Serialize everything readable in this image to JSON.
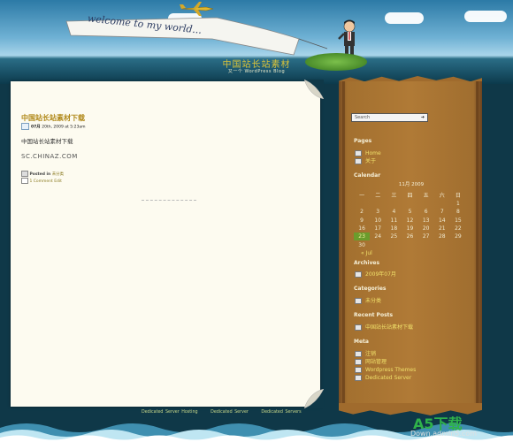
{
  "site": {
    "banner_text": "welcome to my world...",
    "title": "中国站长站素材",
    "tagline": "又一个 WordPress Blog"
  },
  "post": {
    "title": "中国站长站素材下载",
    "date_day": "07月",
    "date_rest": "20th, 2009 at 5:23am",
    "body": "中国站长站素材下载",
    "url_text": "SC.CHINAZ.COM",
    "posted_in_label": "Posted in",
    "category": "未分类",
    "comments_link": "1 Comment Edit"
  },
  "sidebar": {
    "search_placeholder": "Search",
    "pages_heading": "Pages",
    "pages": [
      "Home",
      "关于"
    ],
    "calendar_heading": "Calendar",
    "calendar": {
      "caption": "11月 2009",
      "weekdays": [
        "一",
        "二",
        "三",
        "四",
        "五",
        "六",
        "日"
      ],
      "weeks": [
        [
          "",
          "",
          "",
          "",
          "",
          "",
          "1"
        ],
        [
          "2",
          "3",
          "4",
          "5",
          "6",
          "7",
          "8"
        ],
        [
          "9",
          "10",
          "11",
          "12",
          "13",
          "14",
          "15"
        ],
        [
          "16",
          "17",
          "18",
          "19",
          "20",
          "21",
          "22"
        ],
        [
          "23",
          "24",
          "25",
          "26",
          "27",
          "28",
          "29"
        ],
        [
          "30",
          "",
          "",
          "",
          "",
          "",
          ""
        ]
      ],
      "today": "23",
      "prev_link": "« Jul"
    },
    "archives_heading": "Archives",
    "archives": [
      "2009年07月"
    ],
    "categories_heading": "Categories",
    "categories": [
      "未分类"
    ],
    "recent_heading": "Recent Posts",
    "recent": [
      "中国站长站素材下载"
    ],
    "meta_heading": "Meta",
    "meta": [
      "注销",
      "网站管理",
      "Wordpress Themes",
      "Dedicated Server"
    ]
  },
  "footer": {
    "links": [
      "Dedicated Server Hosting",
      "Dedicated Server",
      "Dedicated Servers"
    ]
  },
  "watermark": {
    "big": "A5下载",
    "small": "Down.admin5.com"
  },
  "colors": {
    "link_yellow": "#f0e06a",
    "title_gold": "#b08818",
    "sidebar_brown": "#b07a36",
    "today_green": "#6a9c2c"
  }
}
